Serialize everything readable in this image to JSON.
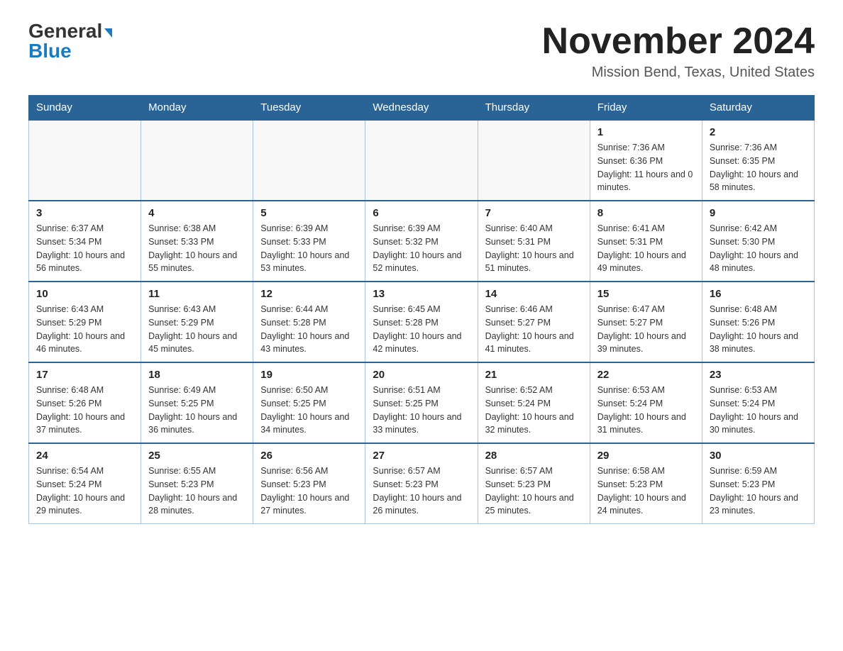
{
  "header": {
    "logo_general": "General",
    "logo_blue": "Blue",
    "main_title": "November 2024",
    "subtitle": "Mission Bend, Texas, United States"
  },
  "calendar": {
    "days_of_week": [
      "Sunday",
      "Monday",
      "Tuesday",
      "Wednesday",
      "Thursday",
      "Friday",
      "Saturday"
    ],
    "weeks": [
      [
        {
          "day": "",
          "info": ""
        },
        {
          "day": "",
          "info": ""
        },
        {
          "day": "",
          "info": ""
        },
        {
          "day": "",
          "info": ""
        },
        {
          "day": "",
          "info": ""
        },
        {
          "day": "1",
          "info": "Sunrise: 7:36 AM\nSunset: 6:36 PM\nDaylight: 11 hours and 0 minutes."
        },
        {
          "day": "2",
          "info": "Sunrise: 7:36 AM\nSunset: 6:35 PM\nDaylight: 10 hours and 58 minutes."
        }
      ],
      [
        {
          "day": "3",
          "info": "Sunrise: 6:37 AM\nSunset: 5:34 PM\nDaylight: 10 hours and 56 minutes."
        },
        {
          "day": "4",
          "info": "Sunrise: 6:38 AM\nSunset: 5:33 PM\nDaylight: 10 hours and 55 minutes."
        },
        {
          "day": "5",
          "info": "Sunrise: 6:39 AM\nSunset: 5:33 PM\nDaylight: 10 hours and 53 minutes."
        },
        {
          "day": "6",
          "info": "Sunrise: 6:39 AM\nSunset: 5:32 PM\nDaylight: 10 hours and 52 minutes."
        },
        {
          "day": "7",
          "info": "Sunrise: 6:40 AM\nSunset: 5:31 PM\nDaylight: 10 hours and 51 minutes."
        },
        {
          "day": "8",
          "info": "Sunrise: 6:41 AM\nSunset: 5:31 PM\nDaylight: 10 hours and 49 minutes."
        },
        {
          "day": "9",
          "info": "Sunrise: 6:42 AM\nSunset: 5:30 PM\nDaylight: 10 hours and 48 minutes."
        }
      ],
      [
        {
          "day": "10",
          "info": "Sunrise: 6:43 AM\nSunset: 5:29 PM\nDaylight: 10 hours and 46 minutes."
        },
        {
          "day": "11",
          "info": "Sunrise: 6:43 AM\nSunset: 5:29 PM\nDaylight: 10 hours and 45 minutes."
        },
        {
          "day": "12",
          "info": "Sunrise: 6:44 AM\nSunset: 5:28 PM\nDaylight: 10 hours and 43 minutes."
        },
        {
          "day": "13",
          "info": "Sunrise: 6:45 AM\nSunset: 5:28 PM\nDaylight: 10 hours and 42 minutes."
        },
        {
          "day": "14",
          "info": "Sunrise: 6:46 AM\nSunset: 5:27 PM\nDaylight: 10 hours and 41 minutes."
        },
        {
          "day": "15",
          "info": "Sunrise: 6:47 AM\nSunset: 5:27 PM\nDaylight: 10 hours and 39 minutes."
        },
        {
          "day": "16",
          "info": "Sunrise: 6:48 AM\nSunset: 5:26 PM\nDaylight: 10 hours and 38 minutes."
        }
      ],
      [
        {
          "day": "17",
          "info": "Sunrise: 6:48 AM\nSunset: 5:26 PM\nDaylight: 10 hours and 37 minutes."
        },
        {
          "day": "18",
          "info": "Sunrise: 6:49 AM\nSunset: 5:25 PM\nDaylight: 10 hours and 36 minutes."
        },
        {
          "day": "19",
          "info": "Sunrise: 6:50 AM\nSunset: 5:25 PM\nDaylight: 10 hours and 34 minutes."
        },
        {
          "day": "20",
          "info": "Sunrise: 6:51 AM\nSunset: 5:25 PM\nDaylight: 10 hours and 33 minutes."
        },
        {
          "day": "21",
          "info": "Sunrise: 6:52 AM\nSunset: 5:24 PM\nDaylight: 10 hours and 32 minutes."
        },
        {
          "day": "22",
          "info": "Sunrise: 6:53 AM\nSunset: 5:24 PM\nDaylight: 10 hours and 31 minutes."
        },
        {
          "day": "23",
          "info": "Sunrise: 6:53 AM\nSunset: 5:24 PM\nDaylight: 10 hours and 30 minutes."
        }
      ],
      [
        {
          "day": "24",
          "info": "Sunrise: 6:54 AM\nSunset: 5:24 PM\nDaylight: 10 hours and 29 minutes."
        },
        {
          "day": "25",
          "info": "Sunrise: 6:55 AM\nSunset: 5:23 PM\nDaylight: 10 hours and 28 minutes."
        },
        {
          "day": "26",
          "info": "Sunrise: 6:56 AM\nSunset: 5:23 PM\nDaylight: 10 hours and 27 minutes."
        },
        {
          "day": "27",
          "info": "Sunrise: 6:57 AM\nSunset: 5:23 PM\nDaylight: 10 hours and 26 minutes."
        },
        {
          "day": "28",
          "info": "Sunrise: 6:57 AM\nSunset: 5:23 PM\nDaylight: 10 hours and 25 minutes."
        },
        {
          "day": "29",
          "info": "Sunrise: 6:58 AM\nSunset: 5:23 PM\nDaylight: 10 hours and 24 minutes."
        },
        {
          "day": "30",
          "info": "Sunrise: 6:59 AM\nSunset: 5:23 PM\nDaylight: 10 hours and 23 minutes."
        }
      ]
    ]
  }
}
